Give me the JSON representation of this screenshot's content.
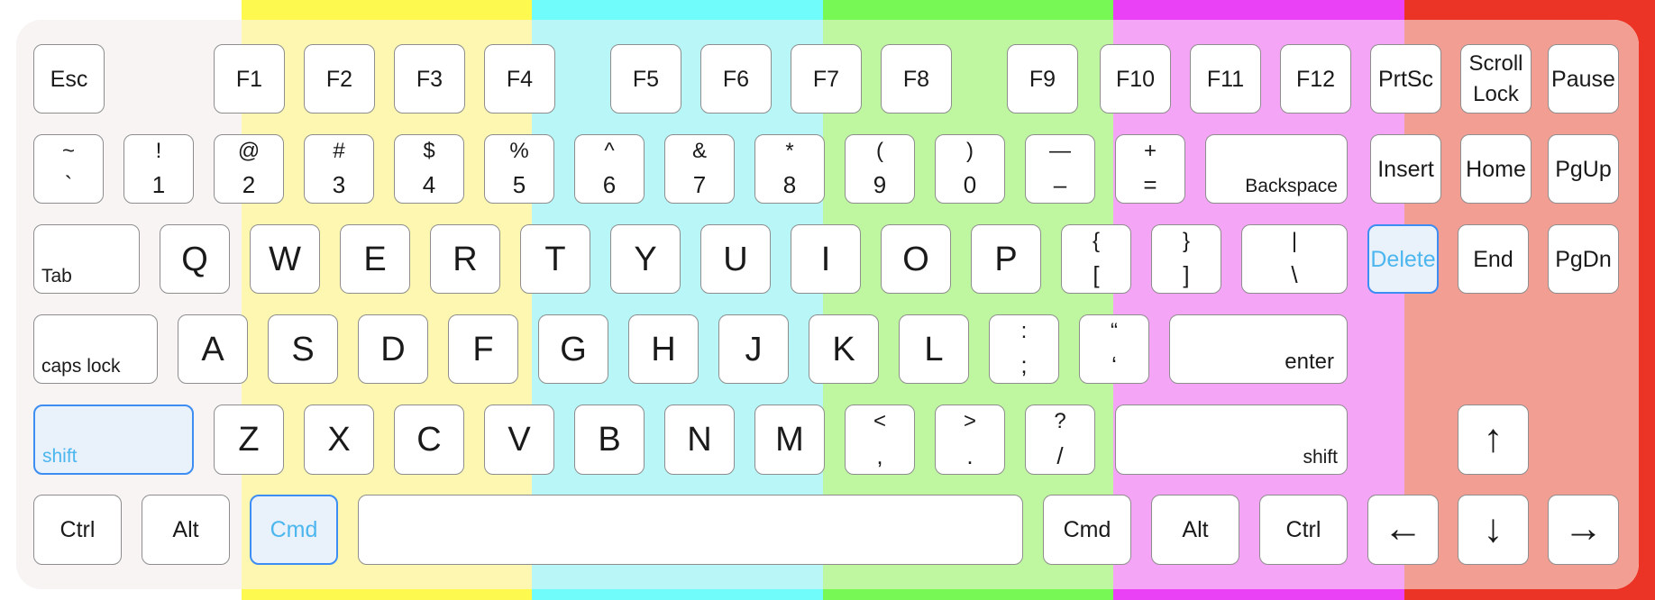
{
  "colors": {
    "band_edge": "#f7f4f3",
    "yellow": "#fef94f",
    "yellow_tint": "#fdf7b1",
    "cyan": "#70fcfb",
    "cyan_tint": "#b9f6f7",
    "green": "#77f854",
    "green_tint": "#bff7a1",
    "magenta": "#ea41f6",
    "magenta_tint": "#f4a5f5",
    "red": "#eb3426",
    "red_tint": "#f39e93",
    "highlight_fill": "#e9f1fb",
    "highlight_border": "#3d8df2",
    "highlight_text": "#4cb6ee"
  },
  "rows": {
    "function": [
      {
        "main": "Esc"
      },
      {
        "main": "F1"
      },
      {
        "main": "F2"
      },
      {
        "main": "F3"
      },
      {
        "main": "F4"
      },
      {
        "main": "F5"
      },
      {
        "main": "F6"
      },
      {
        "main": "F7"
      },
      {
        "main": "F8"
      },
      {
        "main": "F9"
      },
      {
        "main": "F10"
      },
      {
        "main": "F11"
      },
      {
        "main": "F12"
      },
      {
        "main": "PrtSc"
      },
      {
        "line1": "Scroll",
        "line2": "Lock"
      },
      {
        "main": "Pause"
      }
    ],
    "number": [
      {
        "top": "~",
        "bottom": "`"
      },
      {
        "top": "!",
        "bottom": "1"
      },
      {
        "top": "@",
        "bottom": "2"
      },
      {
        "top": "#",
        "bottom": "3"
      },
      {
        "top": "$",
        "bottom": "4"
      },
      {
        "top": "%",
        "bottom": "5"
      },
      {
        "top": "^",
        "bottom": "6"
      },
      {
        "top": "&",
        "bottom": "7"
      },
      {
        "top": "*",
        "bottom": "8"
      },
      {
        "top": "(",
        "bottom": "9"
      },
      {
        "top": ")",
        "bottom": "0"
      },
      {
        "top": "—",
        "bottom": "–"
      },
      {
        "top": "+",
        "bottom": "="
      },
      {
        "label": "Backspace"
      },
      {
        "main": "Insert"
      },
      {
        "main": "Home"
      },
      {
        "main": "PgUp"
      }
    ],
    "qwerty": [
      {
        "label": "Tab"
      },
      {
        "main": "Q"
      },
      {
        "main": "W"
      },
      {
        "main": "E"
      },
      {
        "main": "R"
      },
      {
        "main": "T"
      },
      {
        "main": "Y"
      },
      {
        "main": "U"
      },
      {
        "main": "I"
      },
      {
        "main": "O"
      },
      {
        "main": "P"
      },
      {
        "top": "{",
        "bottom": "["
      },
      {
        "top": "}",
        "bottom": "]"
      },
      {
        "top": "|",
        "bottom": "\\"
      },
      {
        "main": "Delete",
        "highlighted": true
      },
      {
        "main": "End"
      },
      {
        "main": "PgDn"
      }
    ],
    "home": [
      {
        "label": "caps lock"
      },
      {
        "main": "A"
      },
      {
        "main": "S"
      },
      {
        "main": "D"
      },
      {
        "main": "F"
      },
      {
        "main": "G"
      },
      {
        "main": "H"
      },
      {
        "main": "J"
      },
      {
        "main": "K"
      },
      {
        "main": "L"
      },
      {
        "top": ":",
        "bottom": ";"
      },
      {
        "top": "“",
        "bottom": "‘"
      },
      {
        "label": "enter"
      }
    ],
    "shift": [
      {
        "label": "shift",
        "highlighted": true
      },
      {
        "main": "Z"
      },
      {
        "main": "X"
      },
      {
        "main": "C"
      },
      {
        "main": "V"
      },
      {
        "main": "B"
      },
      {
        "main": "N"
      },
      {
        "main": "M"
      },
      {
        "top": "<",
        "bottom": ","
      },
      {
        "top": ">",
        "bottom": "."
      },
      {
        "top": "?",
        "bottom": "/"
      },
      {
        "label": "shift"
      },
      {
        "main": "↑",
        "icon": "arrow-up-icon"
      }
    ],
    "bottom": [
      {
        "main": "Ctrl"
      },
      {
        "main": "Alt"
      },
      {
        "main": "Cmd",
        "highlighted": true
      },
      {
        "main": ""
      },
      {
        "main": "Cmd"
      },
      {
        "main": "Alt"
      },
      {
        "main": "Ctrl"
      },
      {
        "main": "←",
        "icon": "arrow-left-icon"
      },
      {
        "main": "↓",
        "icon": "arrow-down-icon"
      },
      {
        "main": "→",
        "icon": "arrow-right-icon"
      }
    ]
  }
}
